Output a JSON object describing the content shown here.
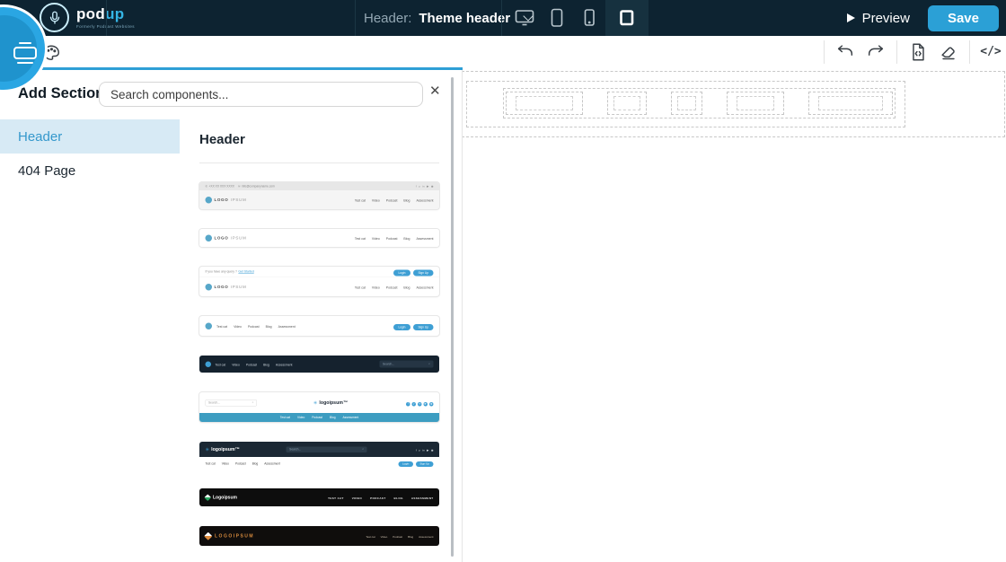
{
  "topbar": {
    "back_icon": "‹",
    "brand_name_a": "pod",
    "brand_name_b": "up",
    "brand_tagline": "Formerly Podcast Websites",
    "header_label": "Header:",
    "header_value": "Theme header",
    "preview_label": "Preview",
    "save_label": "Save",
    "devices": [
      "desktop",
      "tablet",
      "mobile",
      "full-width"
    ],
    "active_device": "full-width",
    "colors": {
      "bar_bg": "#0d2331",
      "save_bg": "#2ba0d6"
    }
  },
  "toolbar": {
    "icons": [
      "palette",
      "undo",
      "redo",
      "export-code",
      "eraser",
      "code-view"
    ],
    "code_glyph": "</>",
    "accent_underline": "#2e9fd6"
  },
  "panel": {
    "title": "Add Section",
    "search_placeholder": "Search components...",
    "close_glyph": "✕",
    "categories": [
      {
        "label": "Header",
        "selected": true
      },
      {
        "label": "404 Page",
        "selected": false
      }
    ],
    "section_title": "Header",
    "selected_color": "#3498cc",
    "selected_bg": "#d7eaf5",
    "thumbnails": [
      "light-header-with-contact-topbar",
      "plain-white-header",
      "white-header-with-query-topbar-and-auth-buttons",
      "white-header-nav-left-auth-right",
      "dark-header-with-search",
      "white-centered-logo-with-blue-navbar",
      "dark-topbar-with-search-and-white-navbar",
      "black-header-green-logo-uppercase-nav",
      "black-header-orange-logo"
    ]
  },
  "thumbs": {
    "nav_links": [
      "Test cat",
      "Video",
      "Podcast",
      "Blog",
      "Assessment"
    ],
    "nav_links_upper": [
      "TEST CAT",
      "VIDEO",
      "PODCAST",
      "BLOG",
      "ASSESSMENT"
    ],
    "logo_caps_a": "LOGO",
    "logo_caps_b": "IPSUM",
    "logo_caps": "LOGOIPSUM",
    "logo_word": "logoipsum™",
    "logo_title": "Logoipsum",
    "phone": "+XX XX XXX XXXX",
    "email": "info@companyname.com",
    "query_text": "If you have any query ?",
    "query_link": "Get Started",
    "login": "Login",
    "signup": "Sign Up",
    "search_placeholder": "Search...",
    "search_glyph": "⌕",
    "social": [
      "f",
      "y",
      "in",
      "▶",
      "◉"
    ],
    "accent": "#3e9fd4"
  },
  "canvas": {
    "menu_slot_count": 5
  }
}
